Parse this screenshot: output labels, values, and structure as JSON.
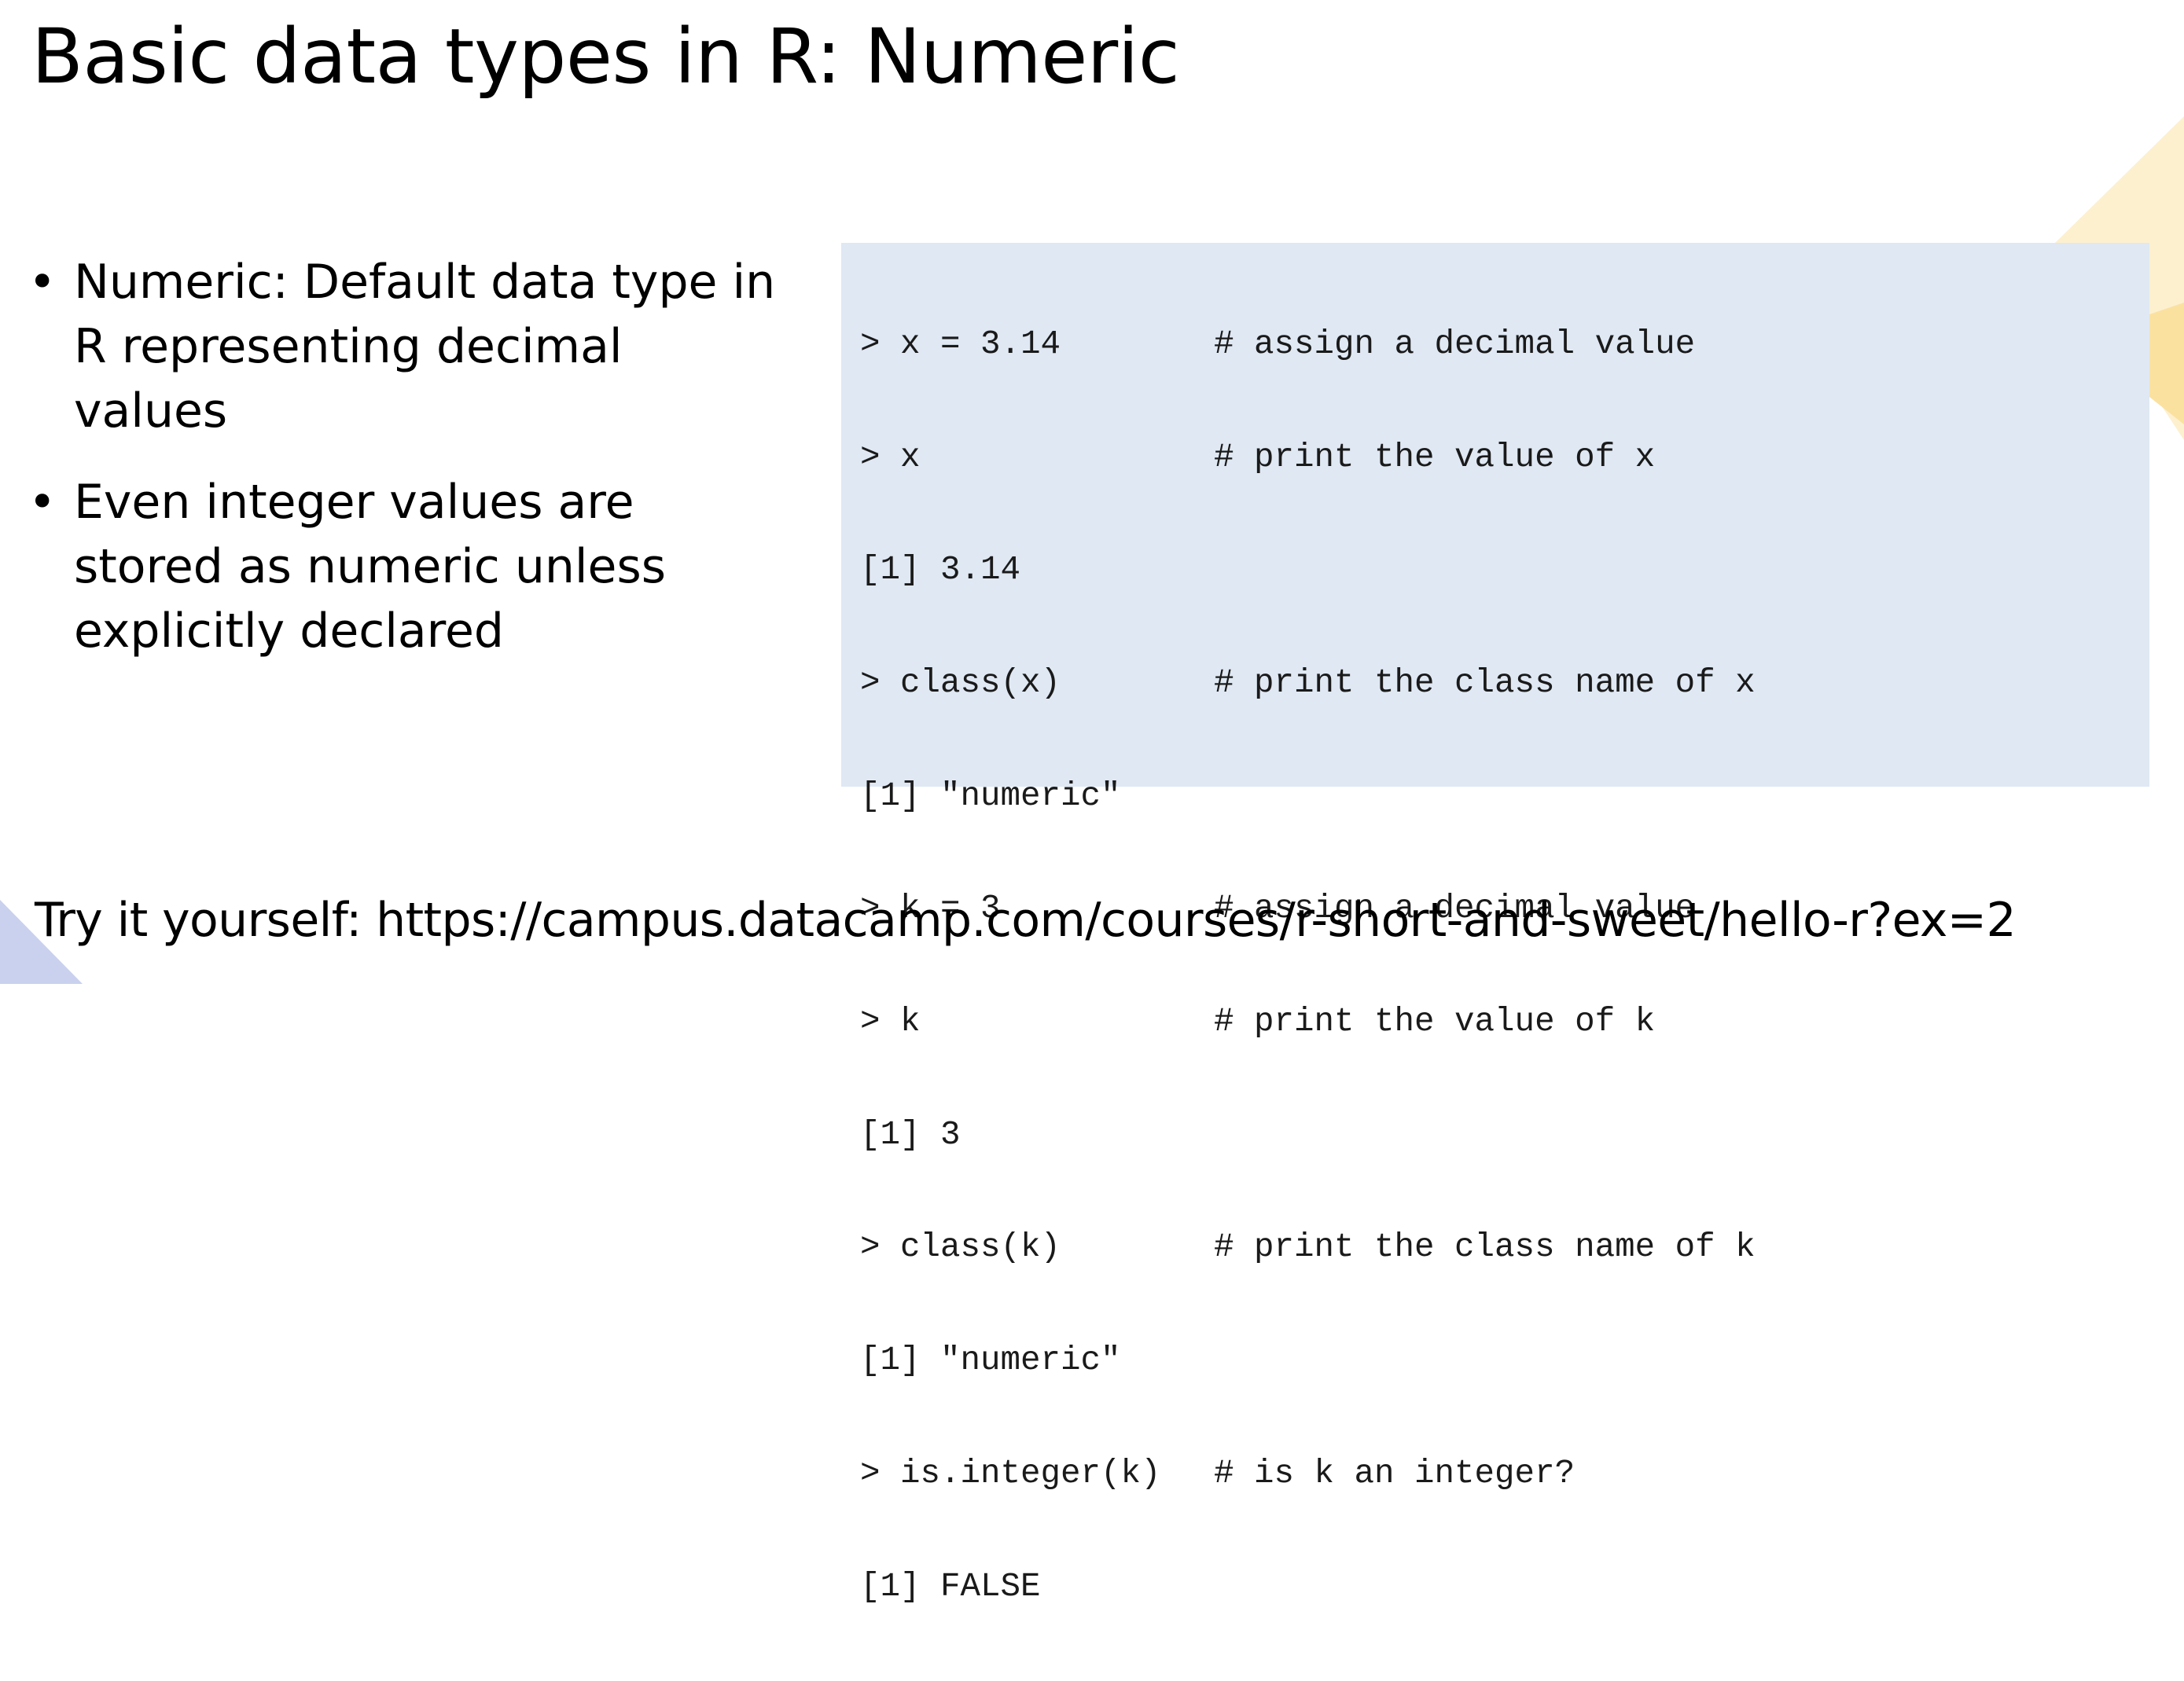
{
  "slide": {
    "title": "Basic data types in R: Numeric",
    "bullets": [
      "Numeric: Default data type in R representing decimal values",
      "Even integer values are stored as numeric unless explicitly declared"
    ],
    "bullet_marker": "•",
    "code_lines": [
      {
        "cmd": "> x = 3.14",
        "comment": "# assign a decimal value"
      },
      {
        "cmd": "> x",
        "comment": "# print the value of x"
      },
      {
        "cmd": "[1] 3.14",
        "comment": ""
      },
      {
        "cmd": "> class(x)",
        "comment": "# print the class name of x"
      },
      {
        "cmd": "[1] \"numeric\"",
        "comment": ""
      },
      {
        "cmd": "> k = 3",
        "comment": "# assign a decimal value"
      },
      {
        "cmd": "> k",
        "comment": "# print the value of k"
      },
      {
        "cmd": "[1] 3",
        "comment": ""
      },
      {
        "cmd": "> class(k)",
        "comment": "# print the class name of k"
      },
      {
        "cmd": "[1] \"numeric\"",
        "comment": ""
      },
      {
        "cmd": "> is.integer(k)",
        "comment": "# is k an integer?"
      },
      {
        "cmd": "[1] FALSE",
        "comment": ""
      }
    ],
    "footer": "Try it yourself: https://campus.datacamp.com/courses/r-short-and-sweet/hello-r?ex=2"
  },
  "colors": {
    "background": "#ffffff",
    "code_background": "#dfe8f3",
    "accent_yellow_light": "#fdf0cf",
    "accent_yellow": "#fbe3a6",
    "accent_blue": "#c5cfee"
  }
}
